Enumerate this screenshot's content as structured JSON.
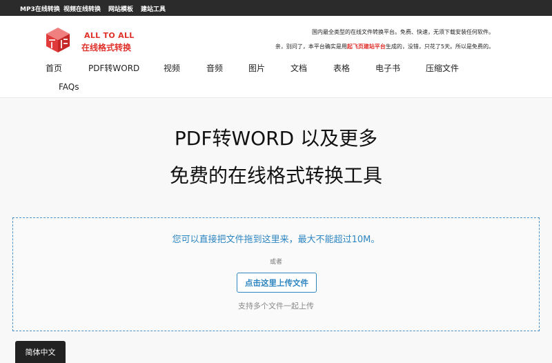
{
  "topbar": {
    "links": [
      "MP3在线转换",
      "视频在线转换",
      "网站模板",
      "建站工具"
    ]
  },
  "header": {
    "logo_en": "ALL TO ALL",
    "logo_cn": "在线格式转换",
    "notice_line1": "国内最全类型的在线文件转换平台。免费、快速，无须下载安装任何软件。",
    "notice_line2_before": "亲，别问了，本平台确实是用",
    "notice_line2_highlight": "起飞页建站平台",
    "notice_line2_after": "生成的，没错，只花了5天。所以是免费的。",
    "accent_color": "#e0302a"
  },
  "nav": {
    "items": [
      "首页",
      "PDF转WORD",
      "视频",
      "音频",
      "图片",
      "文档",
      "表格",
      "电子书",
      "压缩文件",
      "FAQs"
    ]
  },
  "hero": {
    "line1": "PDF转WORD 以及更多",
    "line2": "免费的在线格式转换工具"
  },
  "upload": {
    "hint": "您可以直接把文件拖到这里来，最大不能超过10M。",
    "or_label": "或者",
    "button_label": "点击这里上传文件",
    "multi_note": "支持多个文件一起上传",
    "accent_color": "#2e86c1"
  },
  "language": {
    "label": "简体中文"
  }
}
